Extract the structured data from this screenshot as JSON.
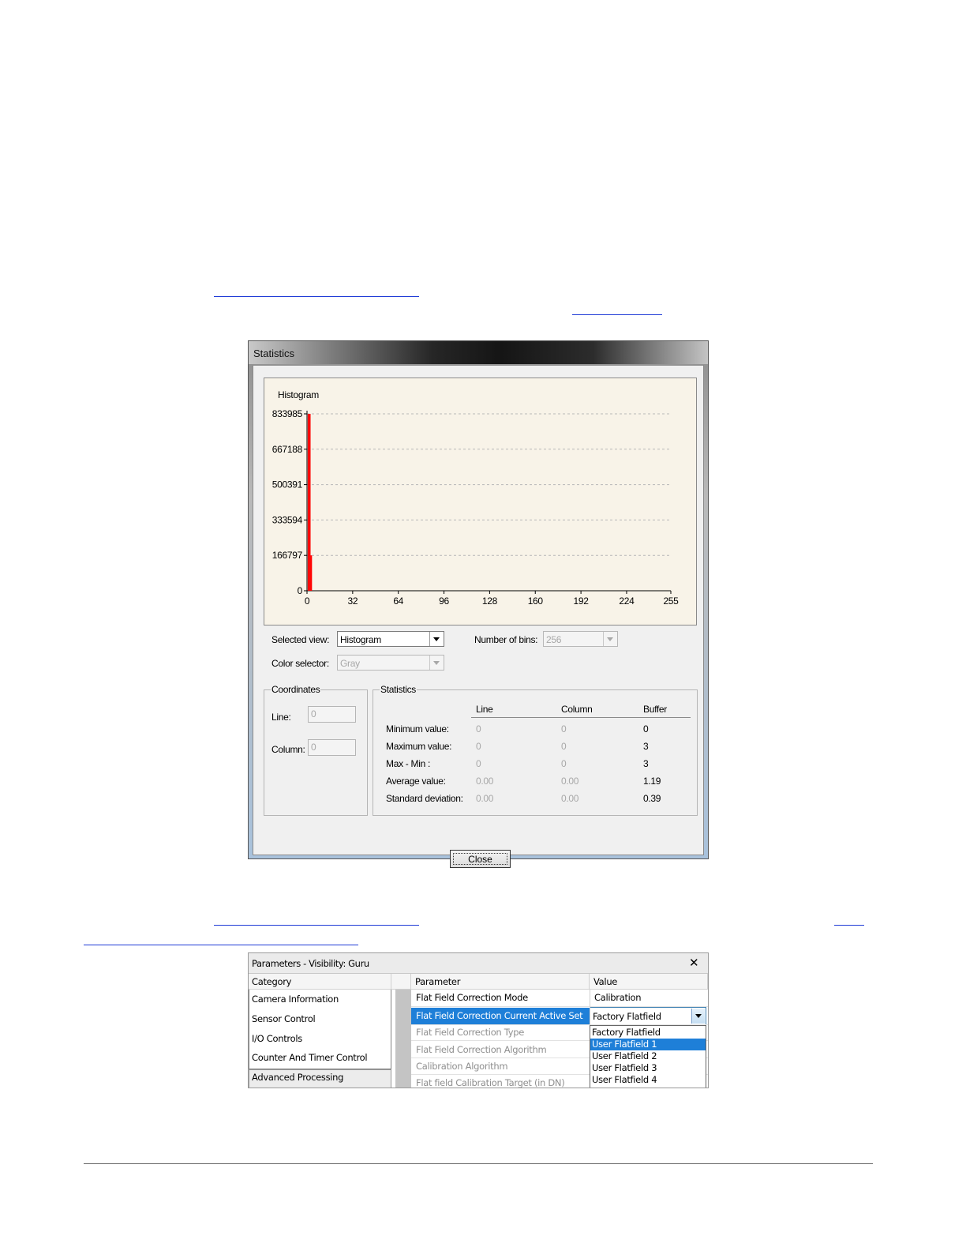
{
  "statistics_dialog": {
    "title": "Statistics",
    "chart_title": "Histogram",
    "selected_view_label": "Selected view:",
    "selected_view_value": "Histogram",
    "number_of_bins_label": "Number of bins:",
    "number_of_bins_value": "256",
    "color_selector_label": "Color selector:",
    "color_selector_value": "Gray",
    "coordinates": {
      "group_label": "Coordinates",
      "line_label": "Line:",
      "line_value": "0",
      "column_label": "Column:",
      "column_value": "0"
    },
    "statistics": {
      "group_label": "Statistics",
      "columns": [
        "Line",
        "Column",
        "Buffer"
      ],
      "rows": [
        {
          "label": "Minimum value:",
          "line": "0",
          "column": "0",
          "buffer": "0"
        },
        {
          "label": "Maximum value:",
          "line": "0",
          "column": "0",
          "buffer": "3"
        },
        {
          "label": "Max - Min :",
          "line": "0",
          "column": "0",
          "buffer": "3"
        },
        {
          "label": "Average value:",
          "line": "0.00",
          "column": "0.00",
          "buffer": "1.19"
        },
        {
          "label": "Standard deviation:",
          "line": "0.00",
          "column": "0.00",
          "buffer": "0.39"
        }
      ]
    },
    "close_label": "Close"
  },
  "chart_data": {
    "type": "bar",
    "title": "Histogram",
    "xlabel": "",
    "ylabel": "",
    "x_ticks": [
      "0",
      "32",
      "64",
      "96",
      "128",
      "160",
      "192",
      "224",
      "255"
    ],
    "y_ticks": [
      "0",
      "166797",
      "333594",
      "500391",
      "667188",
      "833985"
    ],
    "xlim": [
      0,
      255
    ],
    "ylim": [
      0,
      833985
    ],
    "grid": true,
    "bar_color": "#ff0000",
    "x": [
      1,
      2,
      3
    ],
    "values": [
      833985,
      833985,
      166797
    ]
  },
  "parameters_window": {
    "title": "Parameters - Visibility: Guru",
    "close_glyph": "✕",
    "category_header": "Category",
    "categories": [
      "Camera Information",
      "Sensor Control",
      "I/O Controls",
      "Counter And Timer Control",
      "Advanced Processing"
    ],
    "parameter_header": "Parameter",
    "value_header": "Value",
    "rows": [
      {
        "parameter": "Flat Field Correction Mode",
        "value": "Calibration"
      },
      {
        "parameter": "Flat Field Correction Current Active Set",
        "value": "Factory Flatfield"
      },
      {
        "parameter": "Flat Field Correction Type",
        "value": ""
      },
      {
        "parameter": "Flat Field Correction Algorithm",
        "value": ""
      },
      {
        "parameter": "Calibration Algorithm",
        "value": ""
      },
      {
        "parameter": "Flat field Calibration Target (in DN)",
        "value": ""
      }
    ],
    "dropdown_options": [
      "Factory Flatfield",
      "User Flatfield 1",
      "User Flatfield 2",
      "User Flatfield 3",
      "User Flatfield 4"
    ],
    "colors": {
      "selection": "#1e7fd8",
      "accent_link": "#1f3bd6"
    }
  }
}
